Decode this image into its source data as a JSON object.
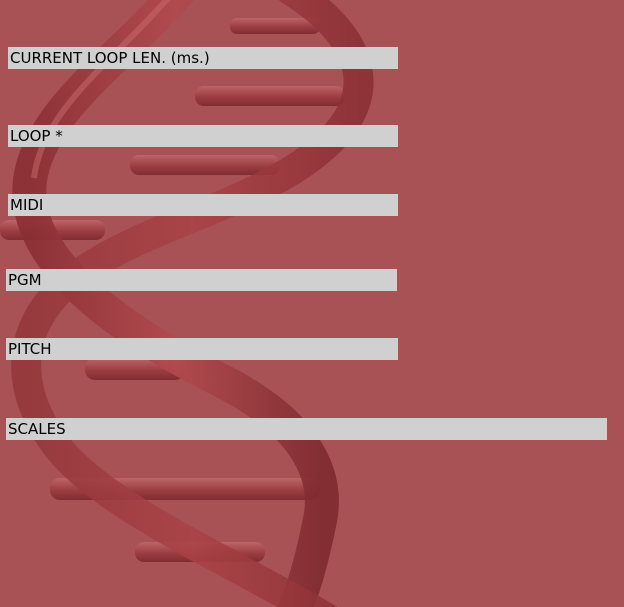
{
  "background": {
    "color": "#a85255",
    "image": "dna-helix-icon",
    "helix_color": "#9a3c40"
  },
  "fields": {
    "current_loop_length": {
      "label": "CURRENT LOOP LEN. (ms.)"
    },
    "loop": {
      "label": "LOOP *"
    },
    "midi": {
      "label": "MIDI"
    },
    "pgm": {
      "label": "PGM"
    },
    "pitch": {
      "label": "PITCH"
    },
    "scales": {
      "label": "SCALES"
    }
  },
  "colors": {
    "field_background": "#d0d0d0",
    "field_text": "#000000"
  }
}
